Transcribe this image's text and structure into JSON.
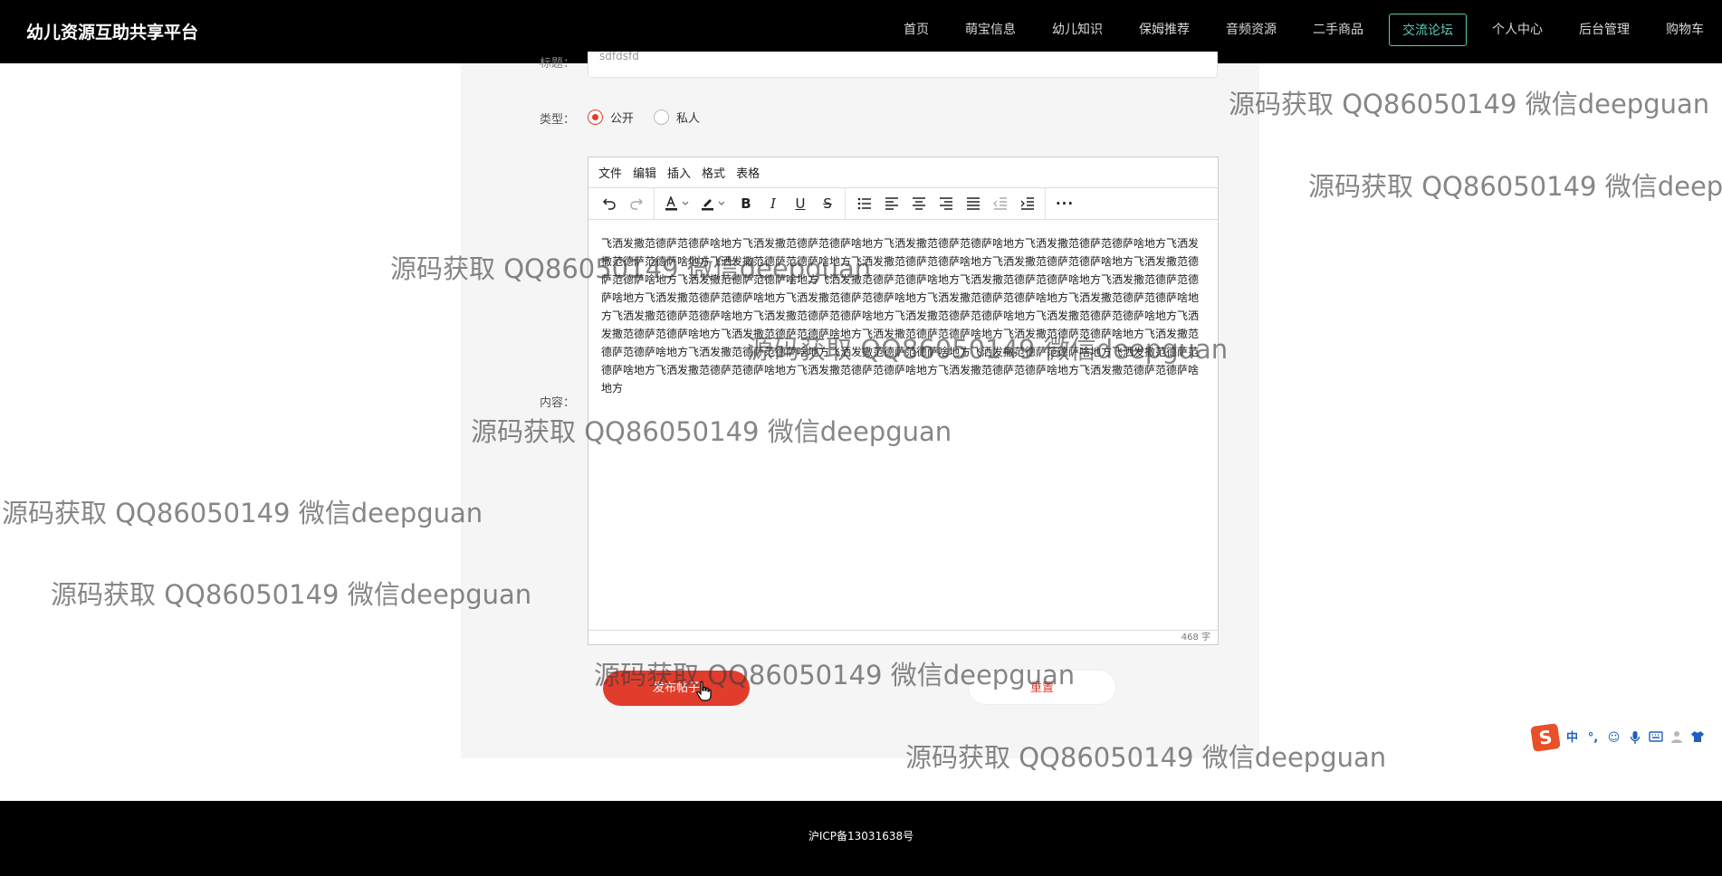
{
  "header": {
    "brand": "幼儿资源互助共享平台",
    "nav": [
      {
        "label": "首页",
        "active": false
      },
      {
        "label": "萌宝信息",
        "active": false
      },
      {
        "label": "幼儿知识",
        "active": false
      },
      {
        "label": "保姆推荐",
        "active": false
      },
      {
        "label": "音频资源",
        "active": false
      },
      {
        "label": "二手商品",
        "active": false
      },
      {
        "label": "交流论坛",
        "active": true
      },
      {
        "label": "个人中心",
        "active": false
      },
      {
        "label": "后台管理",
        "active": false
      },
      {
        "label": "购物车",
        "active": false
      }
    ]
  },
  "form": {
    "title_label": "标题：",
    "title_value": "sdfdsfd",
    "type_label": "类型：",
    "type_options": [
      {
        "label": "公开",
        "checked": true
      },
      {
        "label": "私人",
        "checked": false
      }
    ],
    "content_label": "内容："
  },
  "editor": {
    "menus": [
      "文件",
      "编辑",
      "插入",
      "格式",
      "表格"
    ],
    "icons": {
      "undo": "undo-icon",
      "redo": "redo-icon",
      "font_color": "font-color-icon",
      "highlight": "highlight-icon",
      "bold": "bold-icon",
      "italic": "italic-icon",
      "underline": "underline-icon",
      "strike": "strikethrough-icon",
      "bullet_list": "bullet-list-icon",
      "align_left": "align-left-icon",
      "align_center": "align-center-icon",
      "align_right": "align-right-icon",
      "justify": "justify-icon",
      "outdent": "outdent-icon",
      "indent": "indent-icon",
      "more": "more-icon"
    },
    "content": "飞洒发撒范德萨范德萨啥地方飞洒发撒范德萨范德萨啥地方飞洒发撒范德萨范德萨啥地方飞洒发撒范德萨范德萨啥地方飞洒发撒范德萨范德萨啥地方飞洒发撒范德萨范德萨啥地方飞洒发撒范德萨范德萨啥地方飞洒发撒范德萨范德萨啥地方飞洒发撒范德萨范德萨啥地方飞洒发撒范德萨范德萨啥地方飞洒发撒范德萨范德萨啥地方飞洒发撒范德萨范德萨啥地方飞洒发撒范德萨范德萨啥地方飞洒发撒范德萨范德萨啥地方飞洒发撒范德萨范德萨啥地方飞洒发撒范德萨范德萨啥地方飞洒发撒范德萨范德萨啥地方飞洒发撒范德萨范德萨啥地方飞洒发撒范德萨范德萨啥地方飞洒发撒范德萨范德萨啥地方飞洒发撒范德萨范德萨啥地方飞洒发撒范德萨范德萨啥地方飞洒发撒范德萨范德萨啥地方飞洒发撒范德萨范德萨啥地方飞洒发撒范德萨范德萨啥地方飞洒发撒范德萨范德萨啥地方飞洒发撒范德萨范德萨啥地方飞洒发撒范德萨范德萨啥地方飞洒发撒范德萨范德萨啥地方飞洒发撒范德萨范德萨啥地方飞洒发撒范德萨范德萨啥地方飞洒发撒范德萨范德萨啥地方飞洒发撒范德萨范德萨啥地方飞洒发撒范德萨范德萨啥地方",
    "word_count": "468 字"
  },
  "buttons": {
    "submit": "发布帖子",
    "reset": "重置"
  },
  "footer": {
    "icp": "沪ICP备13031638号"
  },
  "watermark": {
    "text": "源码获取 QQ86050149 微信deepguan",
    "text_clipped": "源码获取 QQ86050149 微信deep"
  },
  "ime": {
    "logo": "S",
    "items": [
      "中",
      "°,",
      "☺",
      "mic",
      "kbd",
      "user",
      "shirt"
    ]
  }
}
